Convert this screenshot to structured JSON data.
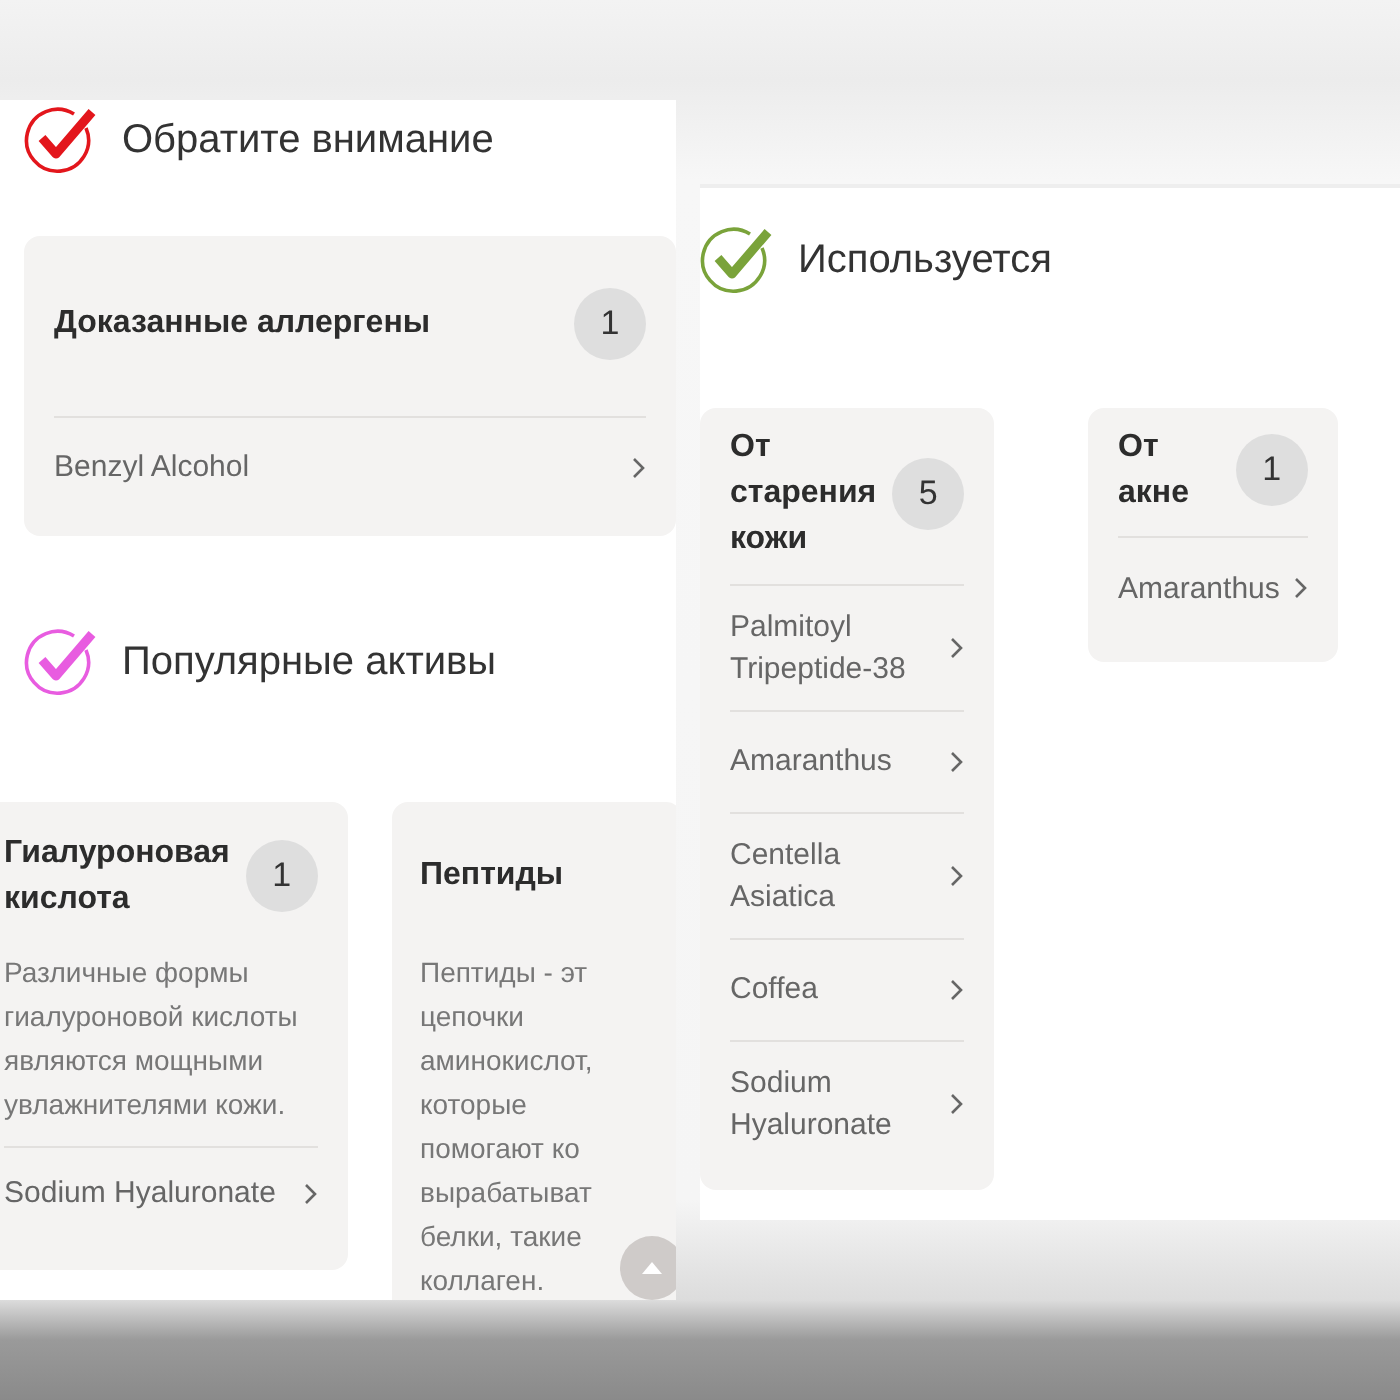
{
  "panels": [
    {
      "sections": [
        {
          "title": "Обратите внимание",
          "color": "#e3161c",
          "kind": "stack",
          "groups": [
            {
              "title": "Доказанные аллергены",
              "count": "1",
              "items": [
                "Benzyl Alcohol"
              ]
            }
          ]
        },
        {
          "title": "Популярные активы",
          "color": "#e85ce0",
          "kind": "carousel",
          "groups": [
            {
              "title": "Гиалуроновая\nкислота",
              "count": "1",
              "description": "Различные формы\nгиалуроновой кислоты\nявляются мощными\nувлажнителями кожи.",
              "items": [
                "Sodium Hyaluronate"
              ]
            },
            {
              "title": "Пептиды",
              "description": "Пептиды - эт\nцепочки\nаминокислот,\nкоторые\nпомогают ко\nвырабатыват\nбелки, такие\nколлаген."
            }
          ]
        }
      ]
    },
    {
      "sections": [
        {
          "title": "Используется",
          "color": "#7aa33a",
          "kind": "columns",
          "groups": [
            {
              "title": "От\nстарения\nкожи",
              "count": "5",
              "items": [
                "Palmitoyl\nTripeptide-38",
                "Amaranthus",
                "Centella\nAsiatica",
                "Coffea",
                "Sodium\nHyaluronate"
              ]
            },
            {
              "title": "От\nакне",
              "count": "1",
              "items": [
                "Amaranthus"
              ]
            }
          ]
        }
      ]
    }
  ]
}
